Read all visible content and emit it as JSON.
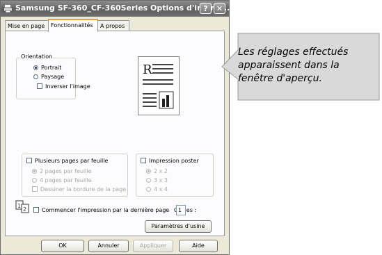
{
  "window": {
    "title": "Samsung SF-360_CF-360Series Options d'impres...",
    "help_glyph": "?",
    "close_glyph": "✕"
  },
  "tabs": [
    "Mise en page",
    "Fonctionnalités",
    "A propos"
  ],
  "orientation": {
    "label": "Orientation",
    "portrait": "Portrait",
    "landscape": "Paysage",
    "invert": "Inverser l'image"
  },
  "preview": {
    "letter": "R"
  },
  "multi_pages": {
    "label": "Plusieurs pages par feuille",
    "opt1": "2 pages par feuille",
    "opt2": "4 pages par feuille",
    "border": "Dessiner la bordure de la page"
  },
  "poster": {
    "label": "Impression poster",
    "opt1": "2 x 2",
    "opt2": "3 x 3",
    "opt3": "4 x 4"
  },
  "reverse": {
    "label": "Commencer l'impression par la dernière page"
  },
  "copies": {
    "label": "Copies :",
    "value": "1"
  },
  "buttons": {
    "factory": "Paramètres d'usine",
    "ok": "OK",
    "cancel": "Annuler",
    "apply": "Appliquer",
    "help": "Aide"
  },
  "callout": {
    "text": "Les réglages effectués apparaissent dans la fenêtre d'aperçu."
  }
}
